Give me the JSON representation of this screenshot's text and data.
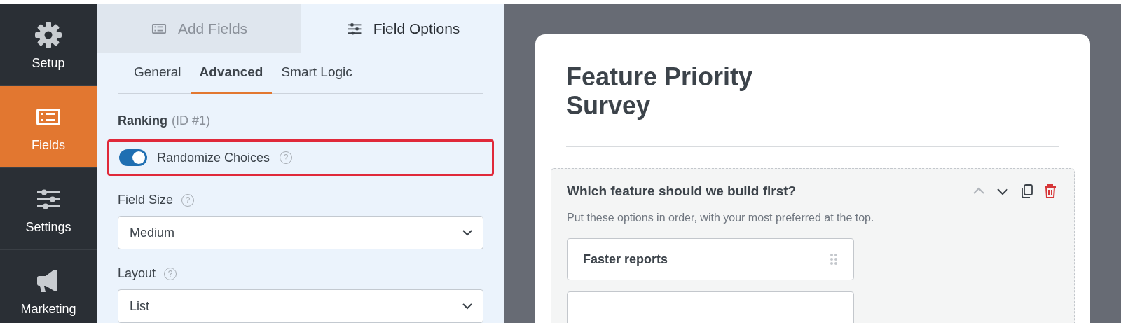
{
  "sidebar": {
    "items": [
      {
        "label": "Setup",
        "kind": "gear",
        "selected": false
      },
      {
        "label": "Fields",
        "kind": "list",
        "selected": true
      },
      {
        "label": "Settings",
        "kind": "sliders",
        "selected": false
      },
      {
        "label": "Marketing",
        "kind": "megaphone",
        "selected": false
      }
    ]
  },
  "panel_tabs": [
    {
      "label": "Add Fields",
      "kind": "list",
      "selected": false
    },
    {
      "label": "Field Options",
      "kind": "sliders",
      "selected": true
    }
  ],
  "sub_tabs": [
    {
      "label": "General",
      "selected": false
    },
    {
      "label": "Advanced",
      "selected": true
    },
    {
      "label": "Smart Logic",
      "selected": false
    }
  ],
  "field_heading": {
    "name": "Ranking",
    "id": "(ID #1)"
  },
  "randomize": {
    "label": "Randomize Choices",
    "on": true,
    "highlighted": true,
    "help": "?"
  },
  "selects": [
    {
      "label": "Field Size",
      "help": "?",
      "value": "Medium"
    },
    {
      "label": "Layout",
      "help": "?",
      "value": "List"
    }
  ],
  "preview": {
    "title": "Feature Priority Survey",
    "question": {
      "label": "Which feature should we build first?",
      "description": "Put these options in order, with your most preferred at the top.",
      "choices": [
        "Faster reports"
      ]
    }
  }
}
